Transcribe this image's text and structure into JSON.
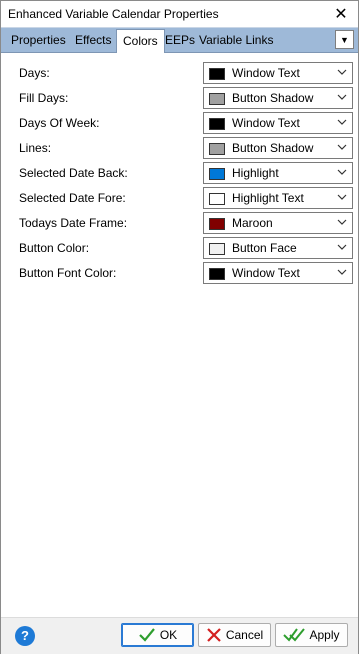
{
  "window": {
    "title": "Enhanced Variable Calendar Properties",
    "close_glyph": "✕"
  },
  "tabs": [
    {
      "label": "Properties",
      "active": false
    },
    {
      "label": "Effects",
      "active": false
    },
    {
      "label": "Colors",
      "active": true
    },
    {
      "label": "EEPs",
      "active": false
    },
    {
      "label": "Variable Links",
      "active": false
    }
  ],
  "tab_menu": {
    "glyph": "▼",
    "icon": "dropdown-icon"
  },
  "color_rows": [
    {
      "label": "Days:",
      "value": "Window Text",
      "swatch": "#000000"
    },
    {
      "label": "Fill Days:",
      "value": "Button Shadow",
      "swatch": "#a0a0a0"
    },
    {
      "label": "Days Of Week:",
      "value": "Window Text",
      "swatch": "#000000"
    },
    {
      "label": "Lines:",
      "value": "Button Shadow",
      "swatch": "#a0a0a0"
    },
    {
      "label": "Selected Date Back:",
      "value": "Highlight",
      "swatch": "#0078d7"
    },
    {
      "label": "Selected Date Fore:",
      "value": "Highlight Text",
      "swatch": "#ffffff"
    },
    {
      "label": "Todays Date Frame:",
      "value": "Maroon",
      "swatch": "#800000"
    },
    {
      "label": "Button Color:",
      "value": "Button Face",
      "swatch": "#f0f0f0"
    },
    {
      "label": "Button Font Color:",
      "value": "Window Text",
      "swatch": "#000000"
    }
  ],
  "footer": {
    "help_glyph": "?",
    "ok_label": "OK",
    "cancel_label": "Cancel",
    "apply_label": "Apply",
    "ok_icon": "check-icon",
    "cancel_icon": "x-icon",
    "apply_icon": "double-check-icon",
    "colors": {
      "ok_check": "#2e9e2e",
      "cancel_x": "#d42020",
      "help": "#1e7ad6",
      "default_border": "#2a7ad4"
    }
  }
}
